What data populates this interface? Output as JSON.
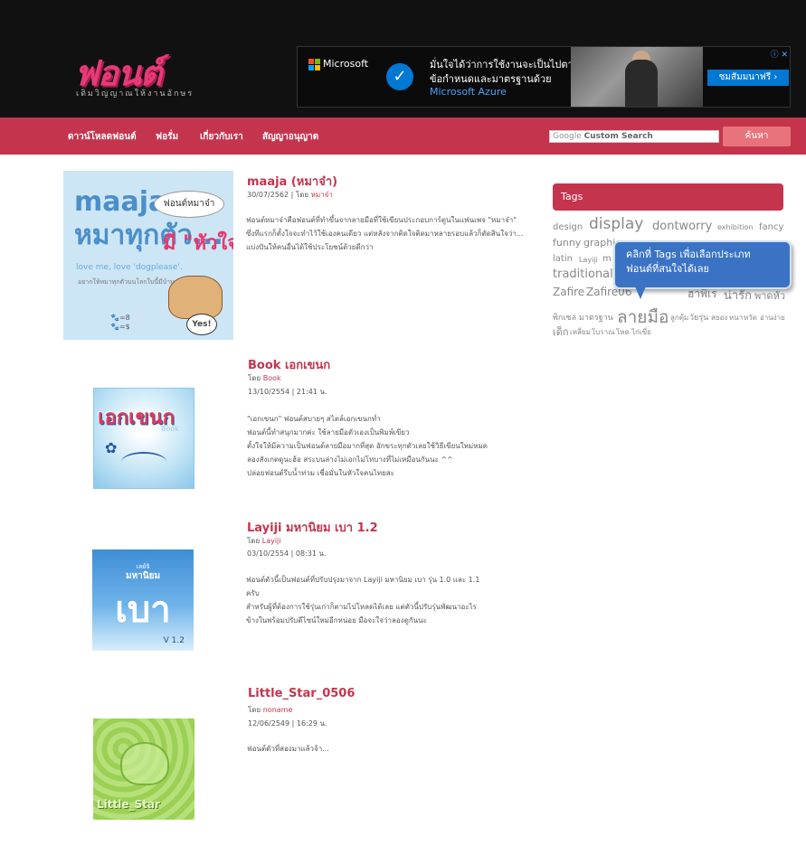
{
  "header": {
    "logo_text": "ฟอนต์",
    "logo_tagline": "เติมวิญญาณให้งานอักษร",
    "ad": {
      "brand": "Microsoft",
      "line1": "มั่นใจได้ว่าการใช้งานจะเป็นไปตาม",
      "line2": "ข้อกำหนดและมาตรฐานด้วย",
      "line3": "Microsoft Azure",
      "cta": "ชมสัมมนาฟรี ›",
      "info": "ⓘ ✕"
    }
  },
  "nav": {
    "items": [
      "ดาวน์โหลดฟอนต์",
      "ฟอรั่ม",
      "เกี่ยวกับเรา",
      "สัญญาอนุญาต"
    ],
    "search_google": "Google",
    "search_placeholder": "Custom Search",
    "search_button": "ค้นหา"
  },
  "posts": [
    {
      "title": "maaja (หมาจ๋า)",
      "date_by": "30/07/2562 | โดย ",
      "author": "หมาจ๋า",
      "excerpt": [
        "ฟอนต์หมาจ๋าคือฟอนต์ที่ทำขึ้นจากลายมือที่ใช้เขียนประกอบการ์ตูนในแฟนเพจ \"หมาจ๋า\"",
        "ซึ่งทีแรกก็ตั้งใจจะทำไว้ใช้เองคนเดียว แต่หลังจากติดใจติดมาหลายรอบแล้วก็ตัดสินใจว่า...",
        "แบ่งปันให้คนอื่นได้ใช้ประโยชน์ด้วยดีกว่า"
      ],
      "thumb": {
        "word1": "maaja",
        "word2": "หมาทุกตัว...",
        "bubble": "ฟอนต์หมาจ๋า",
        "heart": "มี \"หัวใจ\"",
        "small": "love me, love 'dogplease'.",
        "small2": "อยากให้หมาทุกตัวบนโลกใบนี้มีบ้าน",
        "yes": "Yes!",
        "eq": "🐾=8\n🐾=$"
      }
    },
    {
      "title": "Book เอกเขนก",
      "by": "โดย ",
      "author": "Book",
      "date": "13/10/2554 | 21:41 น.",
      "excerpt": [
        "\"เอกเขนก\" ฟอนต์สบายๆ สไตล์เอกเขนกท่ำ",
        "ฟอนต์นี้ทำสนุกมากค่ะ ใช้ลายมือตัวเองเป็นพิมพ์เขียว",
        "ตั้งใจให้มีความเป็นฟอนต์ลายมือมากที่สุด อักขระทุกตัวเลยใช้วิธีเขียนใหม่หมด",
        "ลองสังเกตดูนะฮ้อ สระบนล่างไม่เอกไม่โทบางที่ไม่เหมือนกันนะ ^^",
        "ปล่อยฟอนต์รีบน้ำท่วม เชื่อมั่นในหัวใจคนไทยสะ"
      ],
      "thumb": {
        "word": "เอกเขนก",
        "tag": "Book"
      }
    },
    {
      "title": "Layiji มหานิยม เบา 1.2",
      "by": "โดย ",
      "author": "Layiji",
      "date": "03/10/2554 | 08:31 น.",
      "excerpt": [
        "ฟอนต์ตัวนี้เป็นฟอนต์ที่ปรับปรุงมาจาก Layiji มหานิยม เบา รุ่น 1.0 และ 1.1",
        "ครับ",
        "สำหรับผู้ที่ต้องการใช้รุ่นเก่าก็ตามไปโหลดได้เลย แต่ตัวนี้ปรับรุ่นพัฒนาอะไร",
        "ข้างในพร้อมปรับดีไซน์ใหม่อีกหน่อย มือจะใจว่าลองดูกันนะ"
      ],
      "thumb": {
        "top": "เลย์จิ",
        "sub": "มหานิยม",
        "word": "เบา",
        "ver": "V 1.2"
      }
    },
    {
      "title": "Little_Star_0506",
      "by": "โดย ",
      "author": "noname",
      "date": "12/06/2549 | 16:29 น.",
      "excerpt": [
        "ฟอนต์ตัวที่สองมาแล้วจ้า..."
      ],
      "thumb": {
        "word": "Little_Star"
      }
    }
  ],
  "sidebar": {
    "tags_title": "Tags",
    "tags": [
      {
        "t": "design",
        "s": 10
      },
      {
        "t": "display",
        "s": 17
      },
      {
        "t": "dontworry",
        "s": 13
      },
      {
        "t": "exhibition",
        "s": 8
      },
      {
        "t": "fancy",
        "s": 10
      },
      {
        "t": "funny",
        "s": 11
      },
      {
        "t": "graphic",
        "s": 11
      },
      {
        "t": "latin",
        "s": 10
      },
      {
        "t": "Layiji",
        "s": 8
      },
      {
        "t": "m",
        "s": 10
      },
      {
        "t": "traditional",
        "s": 13
      },
      {
        "t": "Zafire",
        "s": 12
      },
      {
        "t": "Zafire06",
        "s": 12
      },
      {
        "t": "ฮาพิเร",
        "s": 12
      },
      {
        "t": "น่ารัก",
        "s": 13
      },
      {
        "t": "พาดหัว",
        "s": 11
      },
      {
        "t": "พิกเซล",
        "s": 9
      },
      {
        "t": "มาตรฐาน",
        "s": 9
      },
      {
        "t": "ลายมือ",
        "s": 19
      },
      {
        "t": "ลูกตุ้ม",
        "s": 8
      },
      {
        "t": "วัยรุ่น",
        "s": 9
      },
      {
        "t": "สยอง",
        "s": 8
      },
      {
        "t": "หนา",
        "s": 8
      },
      {
        "t": "หวัด",
        "s": 8
      },
      {
        "t": "อ่านง่าย",
        "s": 8
      },
      {
        "t": "เด็ก",
        "s": 11
      },
      {
        "t": "เหลี่ยม",
        "s": 8
      },
      {
        "t": "โบราณ",
        "s": 8
      },
      {
        "t": "โหด",
        "s": 8
      },
      {
        "t": "ไก่เขี่ย",
        "s": 8
      }
    ],
    "callout_line1": "คลิกที่ Tags เพื่อเลือกประเภท",
    "callout_line2": "ฟอนต์ที่สนใจได้เลย"
  },
  "colors": {
    "accent": "#c5344d",
    "header_bg": "#111111",
    "callout": "#3b73c4"
  }
}
